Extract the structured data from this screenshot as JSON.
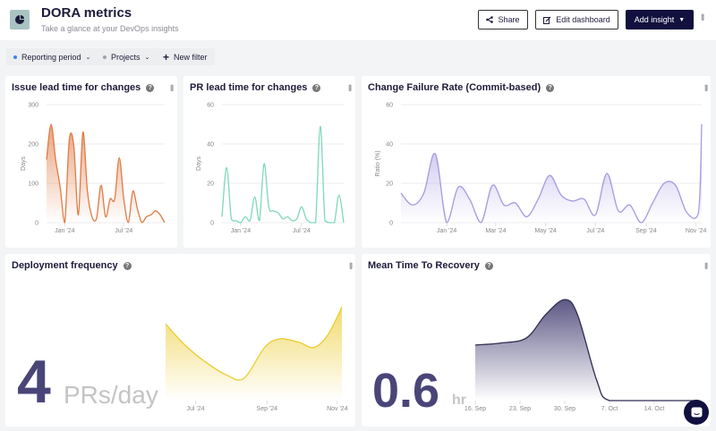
{
  "header": {
    "title": "DORA metrics",
    "subtitle": "Take a glance at your DevOps insights",
    "icon": "pie-chart-icon",
    "share_label": "Share",
    "edit_label": "Edit dashboard",
    "add_label": "Add insight"
  },
  "filters": [
    {
      "label": "Reporting period",
      "dot_color": "#3b82f6"
    },
    {
      "label": "Projects",
      "dot_color": "#9ca3af"
    },
    {
      "label": "New filter"
    }
  ],
  "colors": {
    "issue": "#e07b45",
    "pr": "#7fd9b6",
    "cfr": "#a59ae0",
    "deploy": "#eccb2f",
    "mttr": "#4a4578",
    "navy": "#12103f"
  },
  "cards": {
    "issue": {
      "title": "Issue lead time for changes"
    },
    "pr": {
      "title": "PR lead time for changes"
    },
    "cfr": {
      "title": "Change Failure Rate (Commit-based)"
    },
    "deploy": {
      "title": "Deployment frequency",
      "value": "4",
      "unit": "PRs/day"
    },
    "mttr": {
      "title": "Mean Time To Recovery",
      "value": "0.6",
      "unit": "hr"
    }
  },
  "chart_data": [
    {
      "id": "issue",
      "type": "area",
      "ylabel": "Days",
      "ylim": [
        0,
        300
      ],
      "yticks": [
        0,
        100,
        200,
        300
      ],
      "x": [
        "2023-11-06",
        "2023-11-20",
        "2023-12-04",
        "2023-12-18",
        "2024-01-01",
        "2024-01-15",
        "2024-01-29",
        "2024-02-12",
        "2024-02-26",
        "2024-03-11",
        "2024-03-25",
        "2024-04-08",
        "2024-04-22",
        "2024-05-06",
        "2024-05-20",
        "2024-06-03",
        "2024-06-17",
        "2024-07-01",
        "2024-07-15",
        "2024-07-29",
        "2024-08-12",
        "2024-08-26",
        "2024-09-09",
        "2024-09-23",
        "2024-10-07",
        "2024-10-21",
        "2024-11-04"
      ],
      "values": [
        160,
        250,
        160,
        90,
        0,
        210,
        195,
        20,
        230,
        80,
        15,
        10,
        95,
        15,
        60,
        60,
        165,
        60,
        0,
        80,
        35,
        0,
        15,
        20,
        30,
        20,
        0
      ],
      "xticks": [
        {
          "label": "Jan '24",
          "date": "2024-01-01"
        },
        {
          "label": "Jul '24",
          "date": "2024-07-01"
        }
      ]
    },
    {
      "id": "pr",
      "type": "line",
      "ylabel": "Days",
      "ylim": [
        0,
        60
      ],
      "yticks": [
        0,
        20,
        40,
        60
      ],
      "x": [
        "2023-11-06",
        "2023-11-20",
        "2023-12-04",
        "2023-12-18",
        "2024-01-01",
        "2024-01-15",
        "2024-01-29",
        "2024-02-12",
        "2024-02-26",
        "2024-03-11",
        "2024-03-25",
        "2024-04-08",
        "2024-04-22",
        "2024-05-06",
        "2024-05-20",
        "2024-06-03",
        "2024-06-17",
        "2024-07-01",
        "2024-07-15",
        "2024-07-29",
        "2024-08-12",
        "2024-08-26",
        "2024-09-09",
        "2024-09-23",
        "2024-10-07",
        "2024-10-21",
        "2024-11-04"
      ],
      "values": [
        3,
        28,
        2,
        1,
        0,
        3,
        1,
        13,
        1,
        30,
        8,
        6,
        5,
        2,
        3,
        1,
        2,
        8,
        2,
        0,
        0,
        49,
        1,
        0,
        0,
        14,
        0
      ],
      "xticks": [
        {
          "label": "Jan '24",
          "date": "2024-01-01"
        },
        {
          "label": "Jul '24",
          "date": "2024-07-01"
        }
      ]
    },
    {
      "id": "cfr",
      "type": "area",
      "ylabel": "Ratio (%)",
      "ylim": [
        0,
        60
      ],
      "yticks": [
        0,
        20,
        40,
        60
      ],
      "x": [
        "2023-11-06",
        "2023-11-20",
        "2023-12-04",
        "2023-12-18",
        "2024-01-01",
        "2024-01-15",
        "2024-01-29",
        "2024-02-12",
        "2024-02-26",
        "2024-03-11",
        "2024-03-25",
        "2024-04-08",
        "2024-04-22",
        "2024-05-06",
        "2024-05-20",
        "2024-06-03",
        "2024-06-17",
        "2024-07-01",
        "2024-07-15",
        "2024-07-29",
        "2024-08-12",
        "2024-08-26",
        "2024-09-09",
        "2024-09-23",
        "2024-10-07",
        "2024-10-21",
        "2024-11-04",
        "2024-11-08"
      ],
      "values": [
        15,
        9,
        15,
        35,
        0,
        18,
        12,
        0,
        19,
        9,
        10,
        3,
        12,
        24,
        14,
        11,
        12,
        4,
        25,
        6,
        9,
        0,
        10,
        20,
        19,
        5,
        5,
        50
      ],
      "xticks": [
        {
          "label": "Jan '24",
          "date": "2024-01-01"
        },
        {
          "label": "Mar '24",
          "date": "2024-03-01"
        },
        {
          "label": "May '24",
          "date": "2024-05-01"
        },
        {
          "label": "Jul '24",
          "date": "2024-07-01"
        },
        {
          "label": "Sep '24",
          "date": "2024-09-01"
        },
        {
          "label": "Nov '24",
          "date": "2024-11-01"
        }
      ]
    },
    {
      "id": "deploy",
      "type": "area",
      "ylim": [
        0,
        1
      ],
      "x": [
        "2024-06-05",
        "2024-06-22",
        "2024-07-10",
        "2024-07-28",
        "2024-08-12",
        "2024-08-30",
        "2024-09-12",
        "2024-09-28",
        "2024-10-12",
        "2024-10-24",
        "2024-11-05"
      ],
      "values": [
        0.72,
        0.52,
        0.36,
        0.24,
        0.21,
        0.5,
        0.58,
        0.55,
        0.5,
        0.62,
        0.88
      ],
      "xticks": [
        {
          "label": "Jul '24",
          "date": "2024-07-01"
        },
        {
          "label": "Sep '24",
          "date": "2024-09-01"
        },
        {
          "label": "Nov '24",
          "date": "2024-11-01"
        }
      ]
    },
    {
      "id": "mttr",
      "type": "area",
      "ylim": [
        0,
        1
      ],
      "x": [
        "2024-09-16",
        "2024-09-20",
        "2024-09-24",
        "2024-09-27",
        "2024-09-30",
        "2024-10-02",
        "2024-10-05",
        "2024-10-07",
        "2024-10-14",
        "2024-10-21"
      ],
      "values": [
        0.55,
        0.57,
        0.62,
        0.85,
        1.0,
        0.85,
        0.2,
        0,
        0,
        0
      ],
      "xticks": [
        {
          "label": "16. Sep",
          "date": "2024-09-16"
        },
        {
          "label": "23. Sep",
          "date": "2024-09-23"
        },
        {
          "label": "30. Sep",
          "date": "2024-09-30"
        },
        {
          "label": "7. Oct",
          "date": "2024-10-07"
        },
        {
          "label": "14. Oct",
          "date": "2024-10-14"
        }
      ]
    }
  ]
}
